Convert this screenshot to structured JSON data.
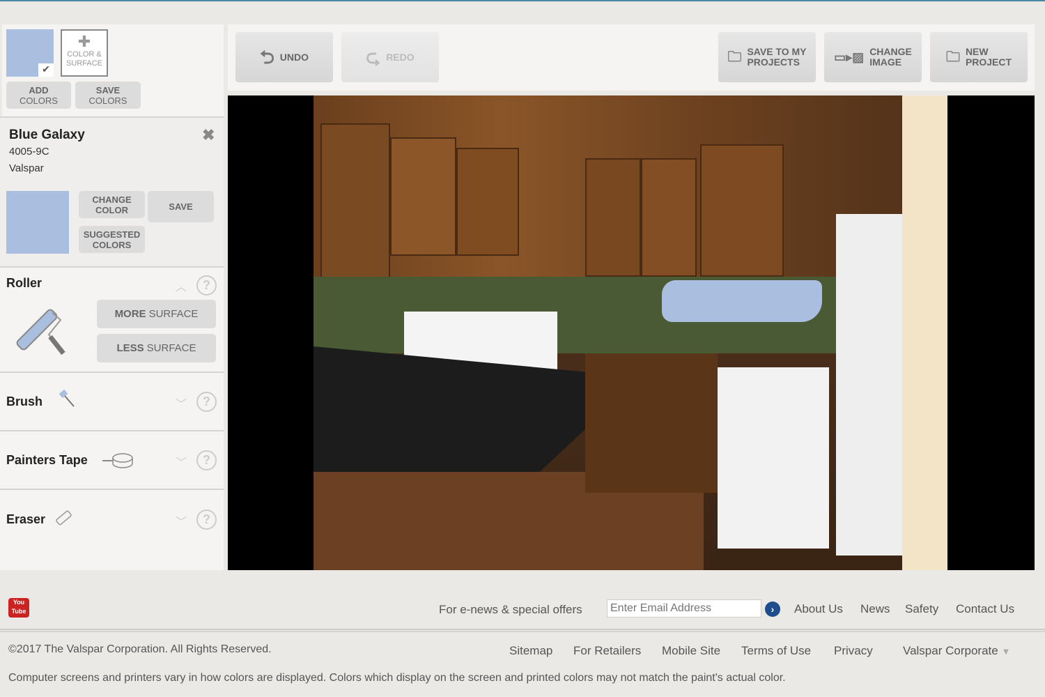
{
  "palette": {
    "swatch_color": "#aabfe0",
    "color_surface_label": "COLOR & SURFACE",
    "add_colors": [
      "ADD",
      "COLORS"
    ],
    "save_colors": [
      "SAVE",
      "COLORS"
    ]
  },
  "selected_color": {
    "name": "Blue Galaxy",
    "code": "4005-9C",
    "brand": "Valspar",
    "hex": "#aabfe0",
    "change_color": [
      "CHANGE",
      "COLOR"
    ],
    "save": "SAVE",
    "suggested": [
      "SUGGESTED",
      "COLORS"
    ]
  },
  "tools": {
    "roller": {
      "label": "Roller",
      "more": [
        "MORE",
        "SURFACE"
      ],
      "less": [
        "LESS",
        "SURFACE"
      ],
      "expanded": true
    },
    "brush": {
      "label": "Brush"
    },
    "tape": {
      "label": "Painters Tape"
    },
    "eraser": {
      "label": "Eraser"
    },
    "help": "?"
  },
  "toolbar": {
    "undo": "UNDO",
    "redo": "REDO",
    "save_projects": [
      "SAVE TO MY",
      "PROJECTS"
    ],
    "change_image": [
      "CHANGE",
      "IMAGE"
    ],
    "new_project": [
      "NEW",
      "PROJECT"
    ]
  },
  "footer": {
    "youtube": "You Tube",
    "enews": "For e-news & special offers",
    "email_placeholder": "Enter Email Address",
    "links_top": [
      "About Us",
      "News",
      "Safety",
      "Contact Us"
    ],
    "copyright": "©2017 The Valspar Corporation. All Rights Reserved.",
    "links_bottom": [
      "Sitemap",
      "For Retailers",
      "Mobile Site",
      "Terms of Use",
      "Privacy"
    ],
    "corporate": "Valspar Corporate",
    "disclaimer": "Computer screens and printers vary in how colors are displayed. Colors which display on the screen and printed colors may not match the paint's actual color."
  }
}
